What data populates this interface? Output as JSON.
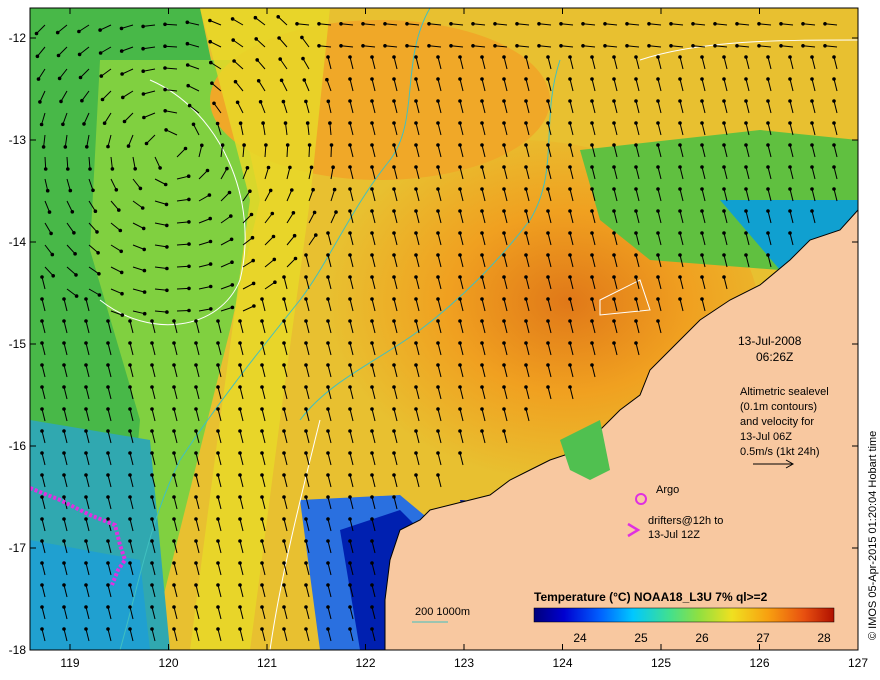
{
  "map": {
    "datetime": {
      "date": "13-Jul-2008",
      "time": "06:26Z"
    },
    "altimetry_note": [
      "Altimetric sealevel",
      "(0.1m contours)",
      "and velocity for",
      "13-Jul 06Z",
      "0.5m/s (1kt 24h)"
    ],
    "legend": {
      "argo": "Argo",
      "drifters": [
        "drifters@12h to",
        "13-Jul 12Z"
      ]
    },
    "bathymetry_label": "200  1000m",
    "colorbar": {
      "title": "Temperature (°C) NOAA18_L3U 7% ql>=2",
      "ticks": [
        "24",
        "25",
        "26",
        "27",
        "28"
      ],
      "colors": [
        "#00007a",
        "#0000d0",
        "#0060ff",
        "#00c8ff",
        "#40e090",
        "#90e040",
        "#f0e020",
        "#f8a010",
        "#e85010",
        "#b01000"
      ]
    },
    "credit": "© IMOS 05-Apr-2015 01:20:04 Hobart time",
    "axes": {
      "lon_ticks": [
        "119",
        "120",
        "121",
        "122",
        "123",
        "124",
        "125",
        "126",
        "127"
      ],
      "lat_ticks": [
        "-12",
        "-13",
        "-14",
        "-15",
        "-16",
        "-17",
        "-18"
      ]
    },
    "colors": {
      "land": "#f8c8a0",
      "ocean_warm": "#f0a020",
      "ocean_mid": "#d0e040",
      "ocean_cool": "#40c050",
      "argo": "#e030e0",
      "bathy": "#40c0c0"
    }
  }
}
